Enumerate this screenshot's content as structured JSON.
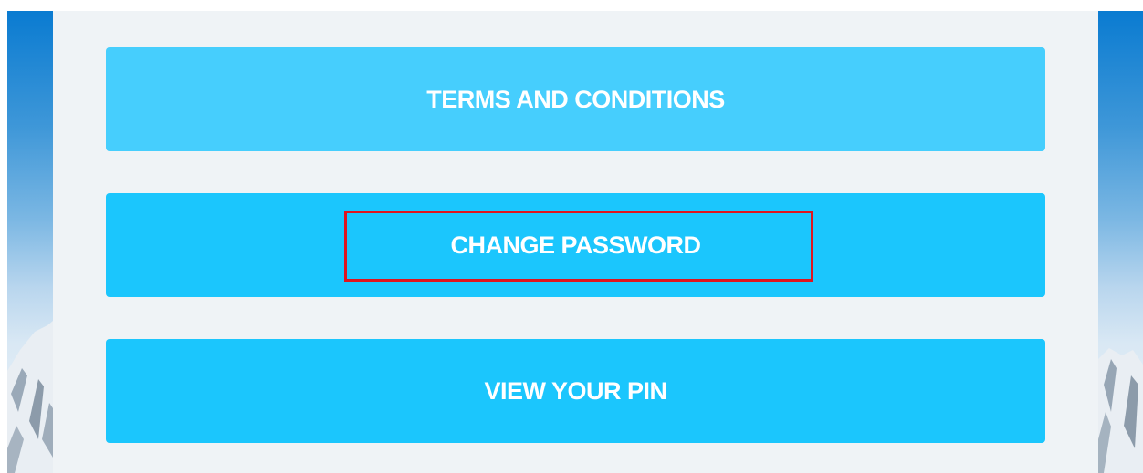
{
  "menu": {
    "terms_label": "TERMS AND CONDITIONS",
    "change_password_label": "CHANGE PASSWORD",
    "view_pin_label": "VIEW YOUR PIN"
  },
  "highlight": {
    "target": "CHANGE PASSWORD",
    "color": "#e0141e"
  },
  "colors": {
    "panel_background": "#eff3f6",
    "button_light": "#46cefd",
    "button_primary": "#1bc6fd",
    "button_text": "#ffffff",
    "sky_top": "#0a7bd1"
  }
}
